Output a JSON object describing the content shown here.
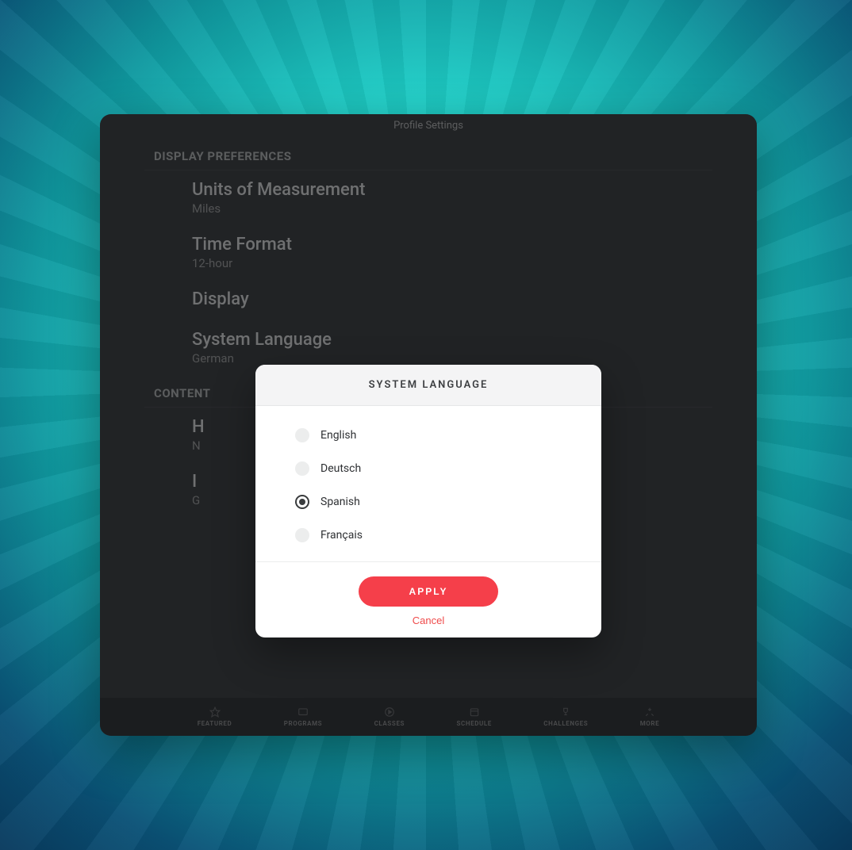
{
  "app": {
    "title": "Profile Settings"
  },
  "sections": {
    "display": {
      "header": "DISPLAY PREFERENCES",
      "rows": [
        {
          "title": "Units of Measurement",
          "value": "Miles"
        },
        {
          "title": "Time Format",
          "value": "12-hour"
        },
        {
          "title": "Display",
          "value": ""
        },
        {
          "title": "System Language",
          "value": "German"
        }
      ]
    },
    "content": {
      "header": "CONTENT",
      "rows": [
        {
          "title": "H",
          "value": "N"
        },
        {
          "title": "I",
          "value": "G"
        }
      ]
    }
  },
  "tabs": [
    {
      "key": "featured",
      "label": "FEATURED"
    },
    {
      "key": "programs",
      "label": "PROGRAMS"
    },
    {
      "key": "classes",
      "label": "CLASSES"
    },
    {
      "key": "schedule",
      "label": "SCHEDULE"
    },
    {
      "key": "challenges",
      "label": "CHALLENGES"
    },
    {
      "key": "more",
      "label": "MORE"
    }
  ],
  "modal": {
    "title": "SYSTEM LANGUAGE",
    "options": [
      {
        "label": "English",
        "selected": false
      },
      {
        "label": "Deutsch",
        "selected": false
      },
      {
        "label": "Spanish",
        "selected": true
      },
      {
        "label": "Français",
        "selected": false
      }
    ],
    "apply": "APPLY",
    "cancel": "Cancel"
  },
  "colors": {
    "accent": "#f53f4a",
    "modalBg": "#ffffff",
    "deviceBg": "#3a3d41"
  }
}
